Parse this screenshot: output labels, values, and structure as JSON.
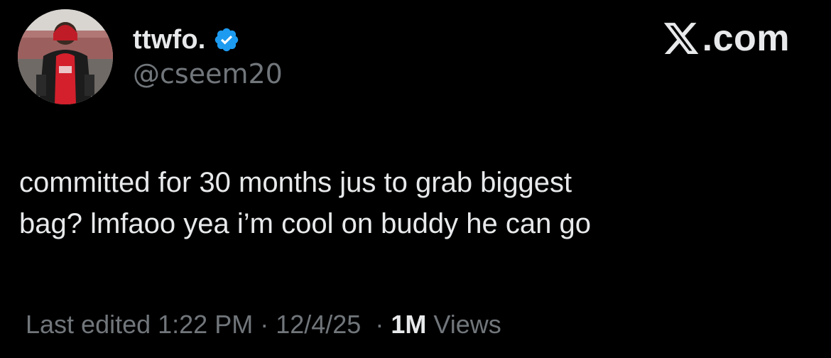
{
  "author": {
    "display_name": "ttwfo.",
    "handle": "@cseem20",
    "verified": true,
    "verified_color": "#1d9bf0"
  },
  "brand": {
    "icon": "x-logo-icon",
    "label": ".com"
  },
  "tweet": {
    "text_line_1": "committed for 30 months jus to grab biggest",
    "text_line_2": "bag? lmfaoo yea i’m cool on buddy he can go"
  },
  "meta": {
    "edited_label": "Last edited 1:22 PM",
    "separator": " · ",
    "date": "12/4/25",
    "separator_2": "  · ",
    "views_count": "1M",
    "views_label": " Views"
  },
  "colors": {
    "background": "#000000",
    "primary_text": "#e7e9ea",
    "secondary_text": "#71767b"
  }
}
